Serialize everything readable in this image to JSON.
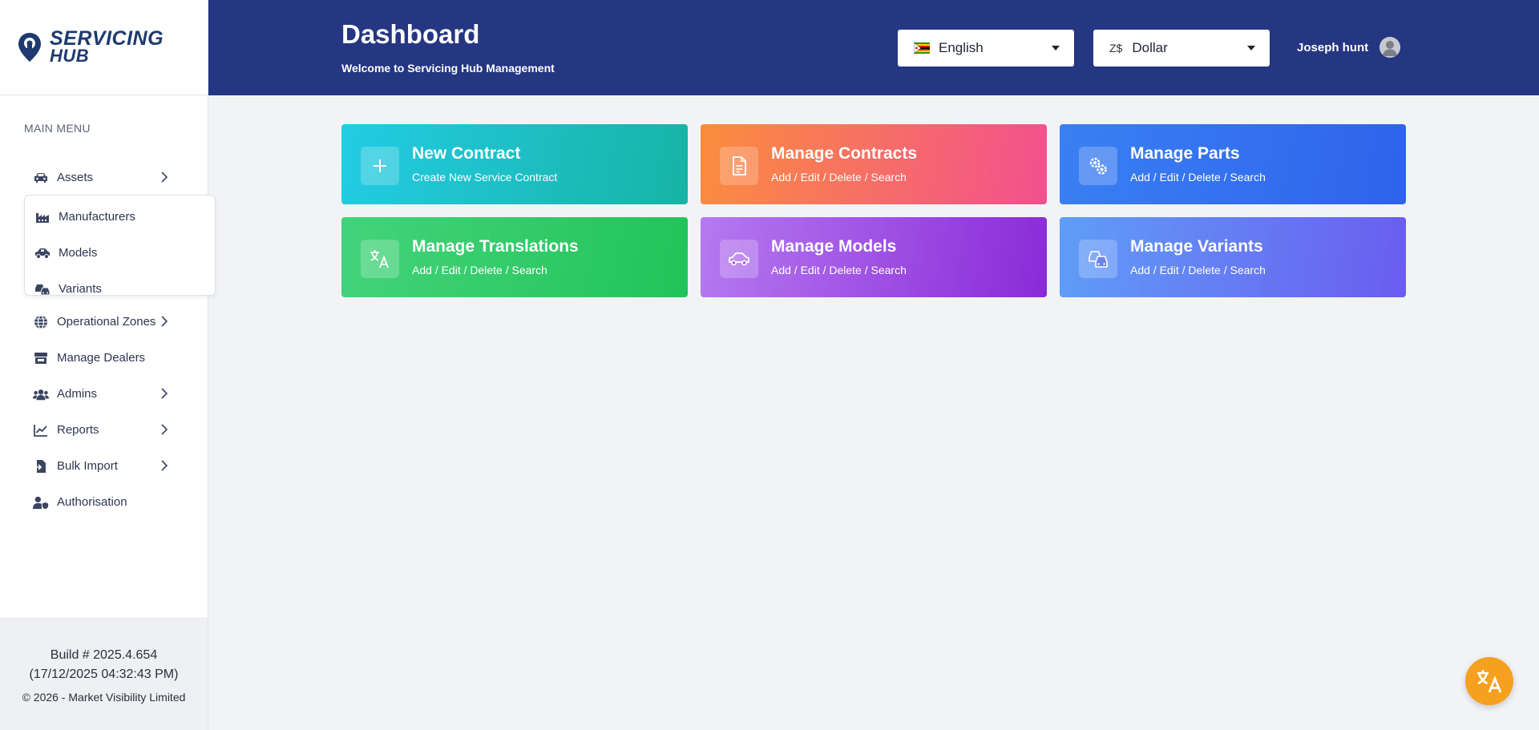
{
  "brand": {
    "line1": "SERVICING",
    "line2": "HUB"
  },
  "sidebar": {
    "caption": "MAIN MENU",
    "items": [
      {
        "label": "Assets",
        "icon": "car-icon",
        "has_submenu": true
      },
      {
        "label": "Operational Zones",
        "icon": "globe-icon",
        "has_submenu": true
      },
      {
        "label": "Manage Dealers",
        "icon": "store-icon",
        "has_submenu": false
      },
      {
        "label": "Admins",
        "icon": "users-icon",
        "has_submenu": true
      },
      {
        "label": "Reports",
        "icon": "chart-line-icon",
        "has_submenu": true
      },
      {
        "label": "Bulk Import",
        "icon": "file-import-icon",
        "has_submenu": true
      },
      {
        "label": "Authorisation",
        "icon": "user-shield-icon",
        "has_submenu": false
      }
    ],
    "assets_submenu": [
      {
        "label": "Manufacturers",
        "icon": "industry-icon"
      },
      {
        "label": "Models",
        "icon": "car-side-icon"
      },
      {
        "label": "Variants",
        "icon": "cars-icon"
      }
    ],
    "footer": {
      "build": "Build # 2025.4.654",
      "build_date": "(17/12/2025 04:32:43 PM)",
      "copyright": "© 2026 - Market Visibility Limited"
    }
  },
  "header": {
    "title": "Dashboard",
    "subtitle": "Welcome to Servicing Hub Management",
    "language": {
      "selected": "English",
      "flag": "zimbabwe-flag-icon"
    },
    "currency": {
      "selected": "Dollar",
      "symbol": "Z$"
    },
    "user_name": "Joseph hunt"
  },
  "cards": [
    {
      "title": "New Contract",
      "subtitle": "Create New Service Contract",
      "icon": "plus-icon"
    },
    {
      "title": "Manage Contracts",
      "subtitle": "Add / Edit / Delete / Search",
      "icon": "file-alt-icon"
    },
    {
      "title": "Manage Parts",
      "subtitle": "Add / Edit / Delete / Search",
      "icon": "cogs-icon"
    },
    {
      "title": "Manage Translations",
      "subtitle": "Add / Edit / Delete / Search",
      "icon": "language-icon"
    },
    {
      "title": "Manage Models",
      "subtitle": "Add / Edit / Delete / Search",
      "icon": "car-icon"
    },
    {
      "title": "Manage Variants",
      "subtitle": "Add / Edit / Delete / Search",
      "icon": "cars-icon"
    }
  ],
  "colors": {
    "header_bg": "#253682",
    "brand": "#1e3a6e",
    "fab": "#f6a01f"
  },
  "fab": {
    "icon": "translate-icon"
  }
}
